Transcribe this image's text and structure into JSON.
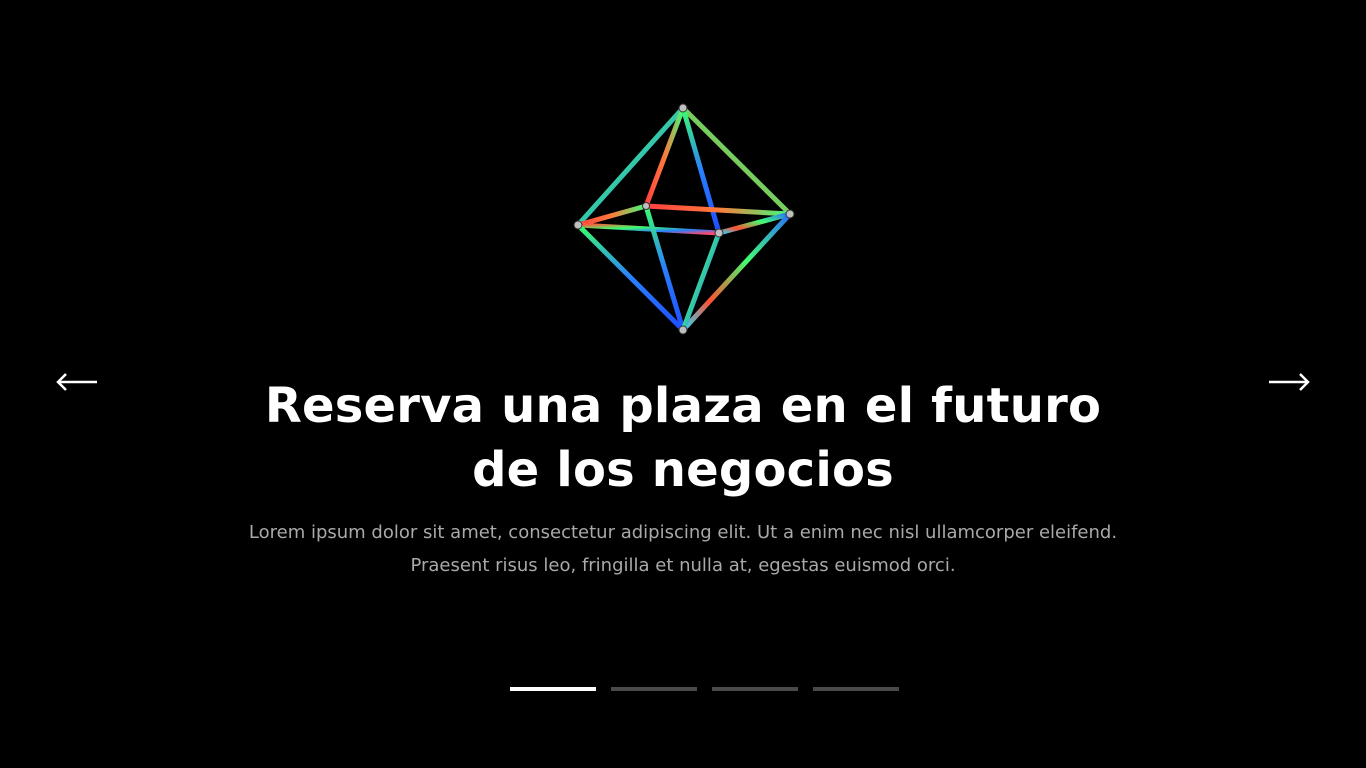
{
  "slider": {
    "prev_icon": "arrow-left-icon",
    "next_icon": "arrow-right-icon",
    "illustration": "octahedron-wireframe-icon",
    "title": "Reserva una plaza en el futuro de los negocios",
    "text": "Lorem ipsum dolor sit amet, consectetur adipiscing elit. Ut a enim nec nisl ullamcorper eleifend. Praesent risus leo, fringilla et nulla at, egestas euismod orci.",
    "pages": [
      {
        "active": true
      },
      {
        "active": false
      },
      {
        "active": false
      },
      {
        "active": false
      }
    ],
    "active_page": 1
  },
  "colors": {
    "background": "#000000",
    "title": "#ffffff",
    "text": "#a9a9a9",
    "dot_active": "#ffffff",
    "dot_inactive": "#4a4a4a"
  }
}
